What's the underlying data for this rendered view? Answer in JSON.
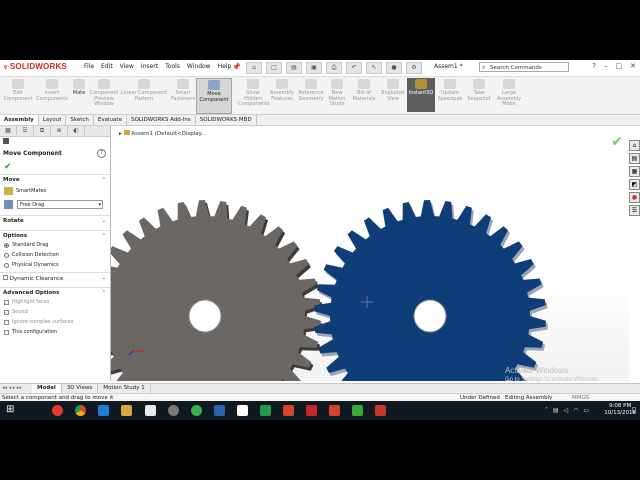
{
  "app": {
    "brand": "SOLIDWORKS",
    "menu": [
      "File",
      "Edit",
      "View",
      "Insert",
      "Tools",
      "Window",
      "Help"
    ],
    "doc_title": "Assem1 *",
    "search_placeholder": "Search Commands"
  },
  "ribbon": [
    {
      "label": "Edit Component",
      "state": "disabled"
    },
    {
      "label": "Insert Components",
      "state": "disabled"
    },
    {
      "label": "Mate",
      "state": "normal"
    },
    {
      "label": "Component Preview Window",
      "state": "disabled"
    },
    {
      "label": "Linear Component Pattern",
      "state": "disabled"
    },
    {
      "label": "Smart Fasteners",
      "state": "disabled"
    },
    {
      "label": "Move Component",
      "state": "active"
    },
    {
      "label": "Show Hidden Components",
      "state": "disabled"
    },
    {
      "label": "Assembly Features",
      "state": "disabled"
    },
    {
      "label": "Reference Geometry",
      "state": "disabled"
    },
    {
      "label": "New Motion Study",
      "state": "disabled"
    },
    {
      "label": "Bill of Materials",
      "state": "disabled"
    },
    {
      "label": "Exploded View",
      "state": "disabled"
    },
    {
      "label": "Instant3D",
      "state": "pressed"
    },
    {
      "label": "Update Speedpak",
      "state": "disabled"
    },
    {
      "label": "Take Snapshot",
      "state": "disabled"
    },
    {
      "label": "Large Assembly Mode",
      "state": "disabled"
    }
  ],
  "tabs": [
    "Assembly",
    "Layout",
    "Sketch",
    "Evaluate",
    "SOLIDWORKS Add-Ins",
    "SOLIDWORKS MBD"
  ],
  "panel": {
    "title": "Move Component",
    "move_header": "Move",
    "smartmates": "SmartMates",
    "move_mode": "Free Drag",
    "rotate_header": "Rotate",
    "options_header": "Options",
    "options": [
      "Standard Drag",
      "Collision Detection",
      "Physical Dynamics"
    ],
    "dynamic_clearance": "Dynamic Clearance",
    "advanced_header": "Advanced Options",
    "advanced": [
      "Highlight faces",
      "Sound",
      "Ignore complex surfaces",
      "This configuration"
    ]
  },
  "viewport": {
    "tree_label": "Assem1 (Default<Display...",
    "gear_left_color": "#6b6764",
    "gear_right_color": "#0f3d78"
  },
  "bottom_tabs": [
    "Model",
    "3D Views",
    "Motion Study 1"
  ],
  "status": {
    "message": "Select a component and drag to move it",
    "under_defined": "Under Defined",
    "editing": "Editing Assembly",
    "units": "MMGS"
  },
  "watermark": {
    "line1": "Activate Windows",
    "line2": "Go to Settings to activate Windows."
  },
  "taskbar": {
    "time": "9:08 PM",
    "date": "10/13/2018"
  }
}
